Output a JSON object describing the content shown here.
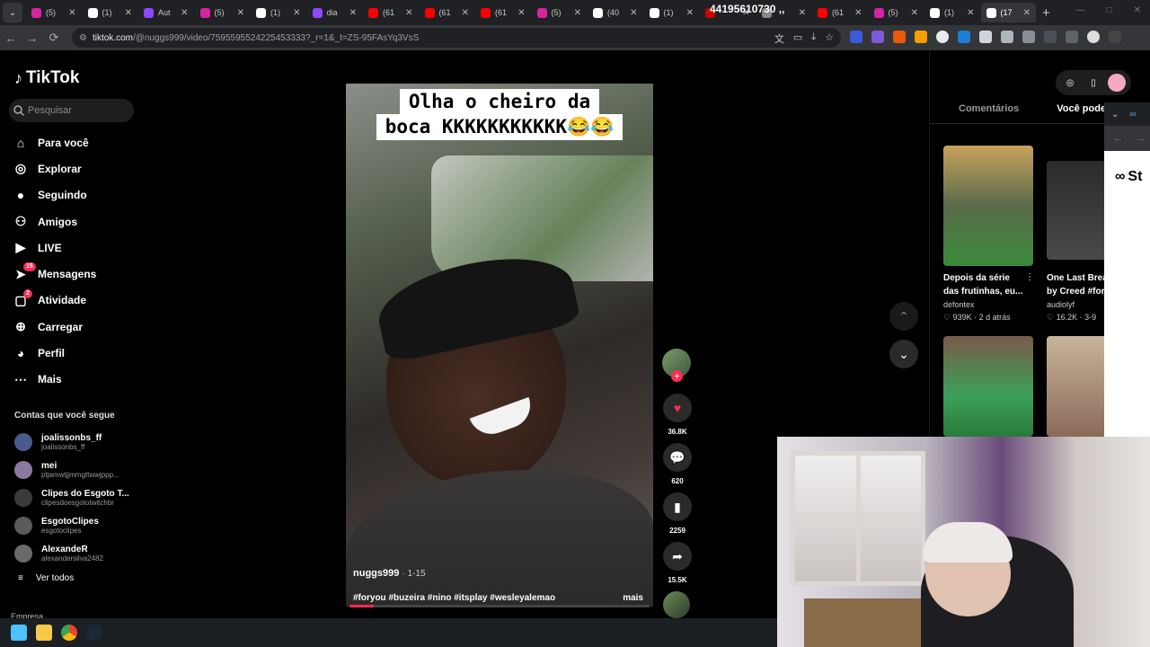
{
  "browser": {
    "tabs": [
      {
        "title": "(5)",
        "icon": "instagram-icon",
        "color": "#d6249f"
      },
      {
        "title": "(1)",
        "icon": "x-icon",
        "color": "#ffffff"
      },
      {
        "title": "Aut",
        "icon": "twitch-icon",
        "color": "#9146ff"
      },
      {
        "title": "(5)",
        "icon": "instagram-icon",
        "color": "#d6249f"
      },
      {
        "title": "(1)",
        "icon": "x-icon",
        "color": "#ffffff"
      },
      {
        "title": "dia",
        "icon": "twitch-icon",
        "color": "#9146ff"
      },
      {
        "title": "(61",
        "icon": "youtube-icon",
        "color": "#ff0000"
      },
      {
        "title": "(61",
        "icon": "youtube-icon",
        "color": "#ff0000"
      },
      {
        "title": "(61",
        "icon": "youtube-icon",
        "color": "#ff0000"
      },
      {
        "title": "(5)",
        "icon": "instagram-icon",
        "color": "#d6249f"
      },
      {
        "title": "(40",
        "icon": "tiktok-icon",
        "color": "#ffffff"
      },
      {
        "title": "(1)",
        "icon": "x-icon",
        "color": "#ffffff"
      },
      {
        "title": "",
        "icon": "red-app-icon",
        "color": "#cc0000"
      },
      {
        "title": "",
        "icon": "generic-icon",
        "color": "#888888"
      },
      {
        "title": "(61",
        "icon": "youtube-icon",
        "color": "#ff0000"
      },
      {
        "title": "(5)",
        "icon": "instagram-icon",
        "color": "#d6249f"
      },
      {
        "title": "(1)",
        "icon": "x-icon",
        "color": "#ffffff"
      },
      {
        "title": "(17",
        "icon": "tiktok-icon",
        "color": "#ffffff",
        "active": true
      }
    ],
    "overlay_number": "44195610730 ,,",
    "url_site": "tiktok.com",
    "url_path": "/@nuggs999/video/7595595524225453333?_r=1&_t=ZS-95FAsYq3VsS"
  },
  "tiktok": {
    "logo": "TikTok",
    "search_placeholder": "Pesquisar",
    "nav": [
      {
        "label": "Para você",
        "icon": "home-icon"
      },
      {
        "label": "Explorar",
        "icon": "compass-icon"
      },
      {
        "label": "Seguindo",
        "icon": "following-avatar-icon"
      },
      {
        "label": "Amigos",
        "icon": "friends-icon"
      },
      {
        "label": "LIVE",
        "icon": "live-icon"
      },
      {
        "label": "Mensagens",
        "icon": "messages-icon",
        "badge": "15"
      },
      {
        "label": "Atividade",
        "icon": "activity-icon",
        "badge": "2"
      },
      {
        "label": "Carregar",
        "icon": "upload-icon"
      },
      {
        "label": "Perfil",
        "icon": "profile-avatar-icon"
      },
      {
        "label": "Mais",
        "icon": "more-icon"
      }
    ],
    "following_heading": "Contas que você segue",
    "following": [
      {
        "name": "joalissonbs_ff",
        "handle": "joalissonbs_ff",
        "color": "#4a5a8a"
      },
      {
        "name": "mei",
        "handle": "ptjamwtjjmmgttwwjppp...",
        "color": "#8a7aa0"
      },
      {
        "name": "Clipes do Esgoto T...",
        "handle": "clipesdoesgototwitchbr",
        "color": "#3a3a3a"
      },
      {
        "name": "EsgotoClipes",
        "handle": "esgotoclipes",
        "color": "#5a5a5a"
      },
      {
        "name": "AlexandeR",
        "handle": "alexandersilva2482",
        "color": "#6a6a6a"
      }
    ],
    "see_all": "Ver todos",
    "company": "Empresa"
  },
  "video": {
    "caption_line1": "Olha o cheiro da",
    "caption_line2": "boca KKKKKKKKKKK😂😂",
    "author": "nuggs999",
    "date": "· 1-15",
    "hashtags": "#foryou #buzeira #nino #itsplay #wesleyalemao",
    "more": "mais",
    "progress": 0.08,
    "likes": "36.8K",
    "comments": "620",
    "saves": "2259",
    "shares": "15.5K"
  },
  "right_panel": {
    "tab_comments": "Comentários",
    "tab_suggested": "Você pode g",
    "videos": [
      {
        "title1": "Depois da série",
        "title2": "das frutinhas, eu...",
        "author": "defontex",
        "stats": "939K · 2 d atrás"
      },
      {
        "title1": "One Last Brea",
        "title2": "by Creed #for",
        "author": "audiolyf",
        "stats": "16.2K · 3-9"
      }
    ],
    "popup_logo": "St"
  }
}
